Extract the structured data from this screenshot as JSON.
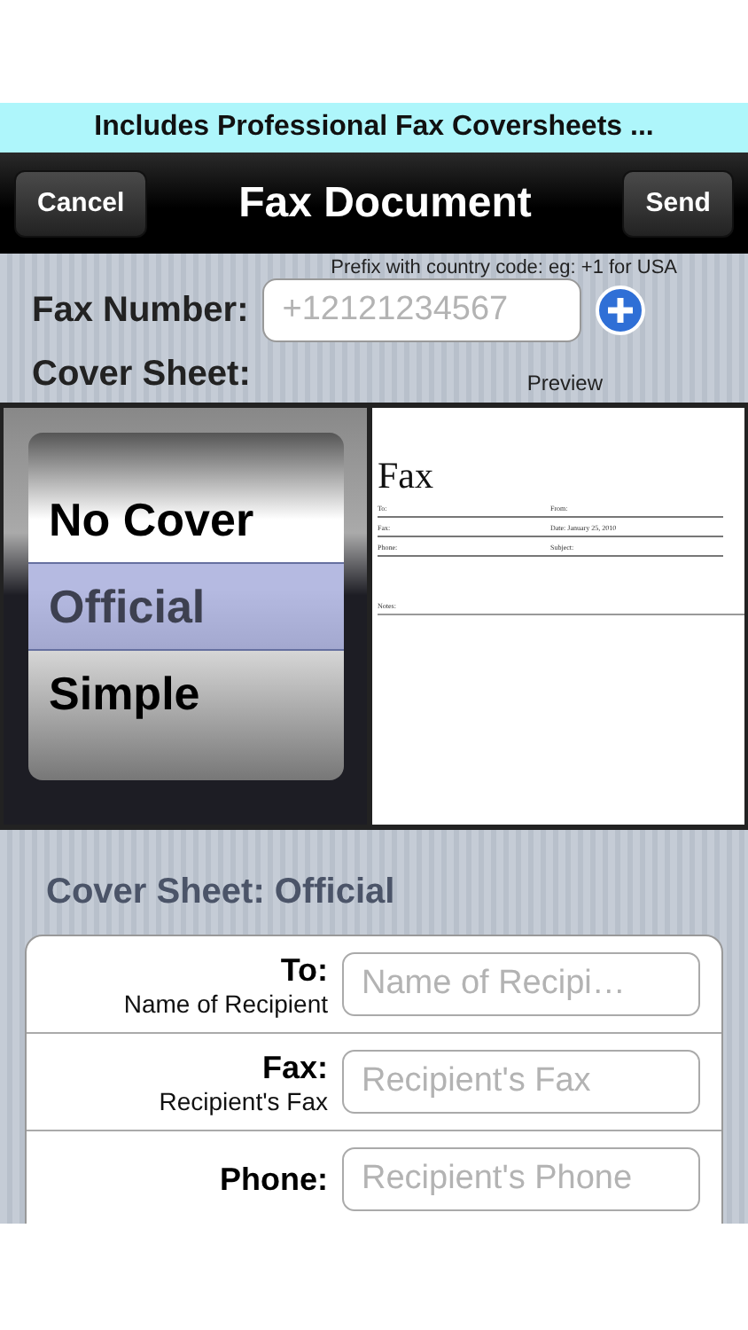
{
  "banner": {
    "text": "Includes Professional Fax Coversheets ..."
  },
  "nav_bar": {
    "left_button": "Cancel",
    "title": "Fax Document",
    "right_button": "Send"
  },
  "fax_number": {
    "hint": "Prefix with country code: eg: +1 for USA",
    "label": "Fax Number:",
    "placeholder": "+12121234567"
  },
  "cover_sheet": {
    "label": "Cover Sheet:",
    "preview_label": "Preview"
  },
  "picker": [
    {
      "label": "No Cover",
      "selected": false
    },
    {
      "label": "Official",
      "selected": true
    },
    {
      "label": "Simple",
      "selected": false
    }
  ],
  "preview": {
    "title": "Fax",
    "rows": [
      {
        "left": "To:",
        "right": "From:"
      },
      {
        "left": "Fax:",
        "right": "Date:   January 25, 2010"
      },
      {
        "left": "Phone:",
        "right": "Subject:"
      }
    ],
    "notes": "Notes:"
  },
  "section_title": "Cover Sheet: Official",
  "form": [
    {
      "label": "To:",
      "sublabel": "Name of Recipient",
      "placeholder": "Name of Recipi…"
    },
    {
      "label": "Fax:",
      "sublabel": "Recipient's Fax",
      "placeholder": "Recipient's Fax"
    },
    {
      "label": "Phone:",
      "placeholder": "Recipient's Phone"
    }
  ]
}
